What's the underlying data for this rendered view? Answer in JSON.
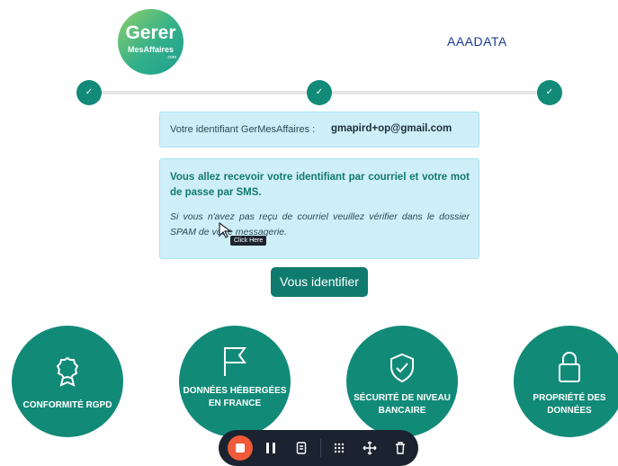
{
  "header": {
    "logo": {
      "line1": "Gerer",
      "line2": "MesAffaires",
      "line3": ".com"
    },
    "brand": "AAADATA"
  },
  "stepper": {
    "steps": [
      "✓",
      "✓",
      "✓"
    ]
  },
  "identifier_box": {
    "label": "Votre identifiant GerMesAffaires :",
    "value": "gmapird+op@gmail.com"
  },
  "info_box": {
    "strong_text": "Vous allez recevoir votre identifiant par courriel et votre mot de passe par SMS.",
    "italic_text": "Si vous n'avez pas reçu de courriel veuillez vérifier dans le dossier SPAM de votre messagerie."
  },
  "tooltip": {
    "text": "Click Here"
  },
  "primary_button": {
    "label": "Vous identifier"
  },
  "features": [
    {
      "label": "CONFORMITÉ RGPD",
      "icon": "award-ribbon-icon"
    },
    {
      "label": "DONNÉES HÉBERGÉES EN FRANCE",
      "icon": "flag-icon"
    },
    {
      "label": "SÉCURITÉ DE NIVEAU BANCAIRE",
      "icon": "shield-check-icon"
    },
    {
      "label": "PROPRIÉTÉ DES DONNÉES",
      "icon": "padlock-icon"
    }
  ],
  "recorder_toolbar": {
    "buttons": [
      "stop-record",
      "pause",
      "notes",
      "grid",
      "move",
      "delete"
    ],
    "accent": "#ef5a3a"
  }
}
